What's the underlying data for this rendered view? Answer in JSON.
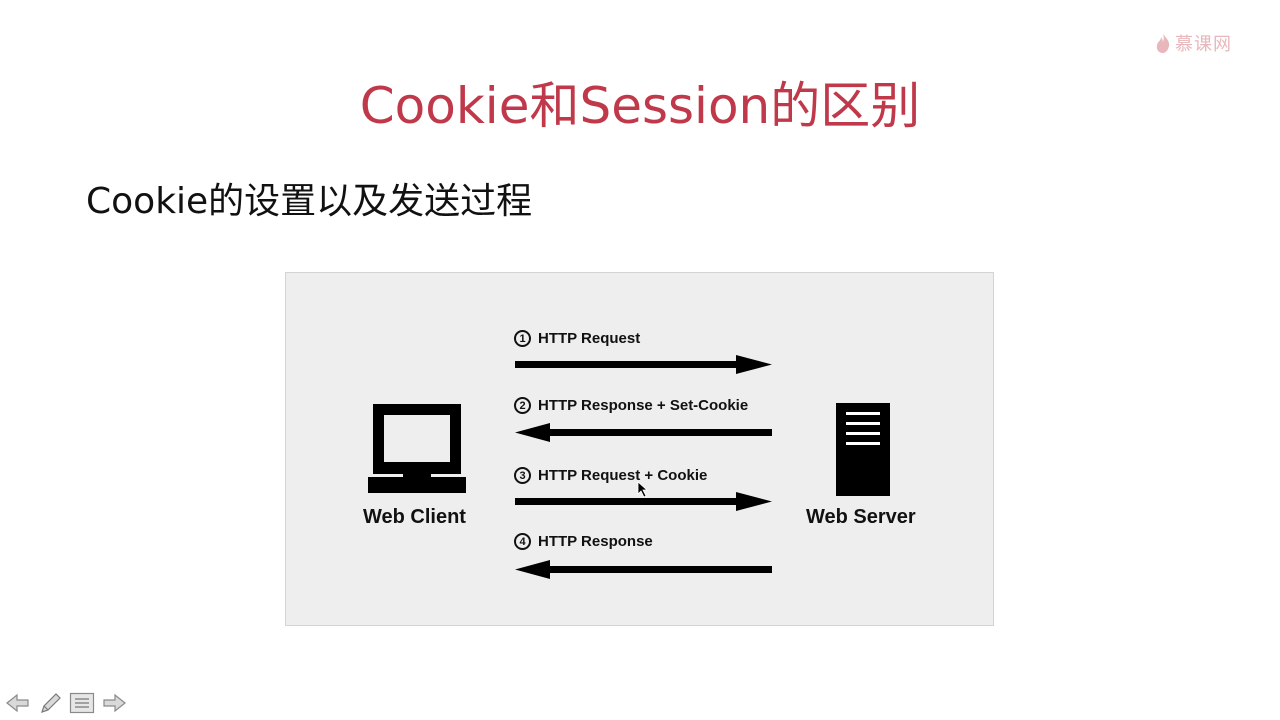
{
  "logo": {
    "text": "慕课网"
  },
  "title": "Cookie和Session的区别",
  "subtitle": "Cookie的设置以及发送过程",
  "diagram": {
    "client_label": "Web Client",
    "server_label": "Web Server",
    "steps": [
      {
        "num": "1",
        "label": "HTTP Request",
        "direction": "right"
      },
      {
        "num": "2",
        "label": "HTTP Response + Set-Cookie",
        "direction": "left"
      },
      {
        "num": "3",
        "label": "HTTP Request + Cookie",
        "direction": "right"
      },
      {
        "num": "4",
        "label": "HTTP Response",
        "direction": "left"
      }
    ]
  },
  "toolbar": {
    "icons": [
      "arrow-left-icon",
      "pen-icon",
      "menu-icon",
      "arrow-right-icon"
    ]
  },
  "colors": {
    "title": "#c0394a",
    "logo": "#e7b7bb",
    "diagram_bg": "#eeeeee"
  }
}
